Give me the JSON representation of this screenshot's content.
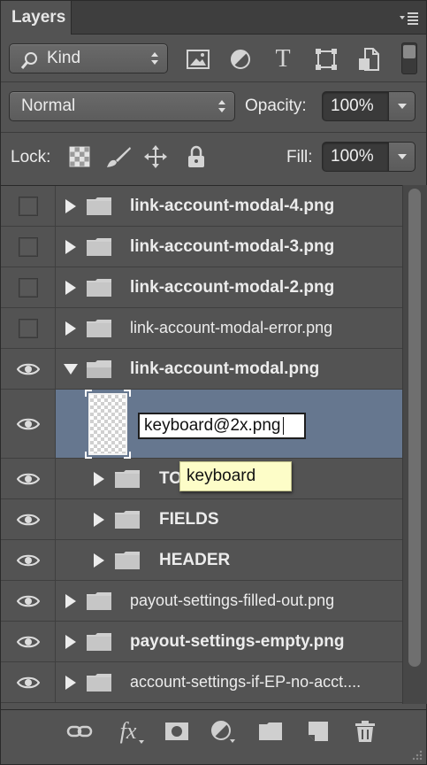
{
  "panel": {
    "tab_title": "Layers"
  },
  "filter": {
    "kind_label": "Kind",
    "icons": [
      "image-filter-icon",
      "adjustment-filter-icon",
      "type-filter-icon",
      "shape-filter-icon",
      "smart-object-filter-icon"
    ],
    "type_glyph": "T"
  },
  "blend": {
    "mode": "Normal",
    "opacity_label": "Opacity:",
    "opacity_value": "100%"
  },
  "lock": {
    "label": "Lock:",
    "fill_label": "Fill:",
    "fill_value": "100%"
  },
  "layers": [
    {
      "name": "link-account-modal-4.png",
      "bold": true,
      "visible": false,
      "expanded": false,
      "indent": 0
    },
    {
      "name": "link-account-modal-3.png",
      "bold": true,
      "visible": false,
      "expanded": false,
      "indent": 0
    },
    {
      "name": "link-account-modal-2.png",
      "bold": true,
      "visible": false,
      "expanded": false,
      "indent": 0
    },
    {
      "name": "link-account-modal-error.png",
      "bold": false,
      "visible": false,
      "expanded": false,
      "indent": 0
    },
    {
      "name": "link-account-modal.png",
      "bold": true,
      "visible": true,
      "expanded": true,
      "indent": 0
    },
    {
      "name": "keyboard@2x.png",
      "bold": false,
      "visible": true,
      "selected": true,
      "editing": true,
      "indent": 1
    },
    {
      "name": "TO",
      "bold": true,
      "visible": true,
      "expanded": false,
      "indent": 1
    },
    {
      "name": "FIELDS",
      "bold": true,
      "visible": true,
      "expanded": false,
      "indent": 1
    },
    {
      "name": "HEADER",
      "bold": true,
      "visible": true,
      "expanded": false,
      "indent": 1
    },
    {
      "name": "payout-settings-filled-out.png",
      "bold": false,
      "visible": true,
      "expanded": false,
      "indent": 0
    },
    {
      "name": "payout-settings-empty.png",
      "bold": true,
      "visible": true,
      "expanded": false,
      "indent": 0
    },
    {
      "name": "account-settings-if-EP-no-acct....",
      "bold": false,
      "visible": true,
      "expanded": false,
      "indent": 0
    }
  ],
  "tooltip": {
    "text": "keyboard"
  },
  "footer": {
    "fx_label": "fx",
    "icons": [
      "link-layers-icon",
      "layer-style-icon",
      "layer-mask-icon",
      "adjustment-layer-icon",
      "new-group-icon",
      "new-layer-icon",
      "delete-layer-icon"
    ]
  },
  "colors": {
    "panel_bg": "#535353",
    "selected_row": "#66778f",
    "tooltip_bg": "#fdfdc8"
  }
}
